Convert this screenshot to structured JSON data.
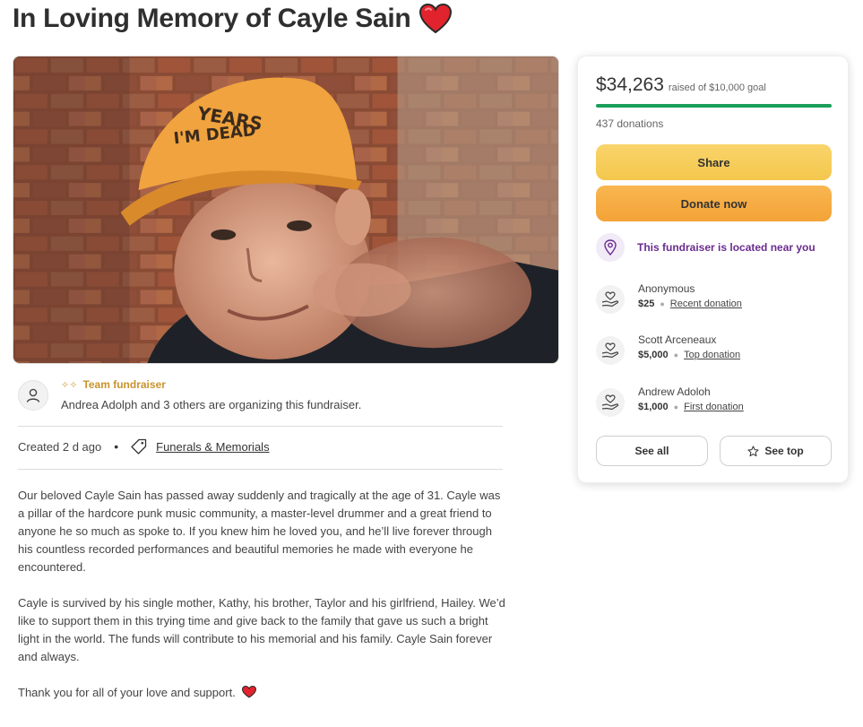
{
  "page": {
    "title": "In Loving Memory of Cayle Sain"
  },
  "organizer": {
    "team_label": "Team fundraiser",
    "text": "Andrea Adolph and 3 others are organizing this fundraiser."
  },
  "meta": {
    "created": "Created 2 d ago",
    "dot": "•",
    "category": "Funerals & Memorials"
  },
  "story": {
    "paragraphs": [
      "Our beloved Cayle Sain has passed away suddenly and tragically at the age of 31. Cayle was a pillar of the hardcore punk music community, a master-level drummer and a great friend to anyone he so much as spoke to. If you knew him he loved you, and he’ll live forever through his countless recorded performances and beautiful memories he made with everyone he encountered.",
      "Cayle is survived by his single mother, Kathy, his brother, Taylor and his girlfriend, Hailey. We’d like to support them in this trying time and give back to the family that gave us such a bright light in the world. The funds will contribute to his memorial and his family. Cayle Sain forever and always.",
      "Thank you for all of your love and support."
    ]
  },
  "donation_card": {
    "raised_amount": "$34,263",
    "goal_text": "raised of $10,000 goal",
    "progress_fraction": 1.0,
    "donations_count": "437 donations",
    "share_label": "Share",
    "donate_label": "Donate now",
    "nearby_text": "This fundraiser is located near you",
    "donors": [
      {
        "name": "Anonymous",
        "amount": "$25",
        "kind": "Recent donation"
      },
      {
        "name": "Scott Arceneaux",
        "amount": "$5,000",
        "kind": "Top donation"
      },
      {
        "name": "Andrew Adoloh",
        "amount": "$1,000",
        "kind": "First donation"
      }
    ],
    "see_all_label": "See all",
    "see_top_label": "See top"
  },
  "photo": {
    "cap_text_1": "YEARS",
    "cap_text_2": "I'M DEAD"
  },
  "colors": {
    "progress_green": "#1a9f5a",
    "share_yellow": "#f6cb5a",
    "donate_orange": "#f5aa40",
    "nearby_purple": "#6a2c8f",
    "team_gold": "#c9932e",
    "heart_red": "#e0232d"
  },
  "icons": {
    "title_heart": "red-heart-icon",
    "avatar": "user-icon",
    "tag": "tag-icon",
    "location": "location-pin-icon",
    "donor": "heart-hand-icon",
    "star": "star-icon"
  }
}
